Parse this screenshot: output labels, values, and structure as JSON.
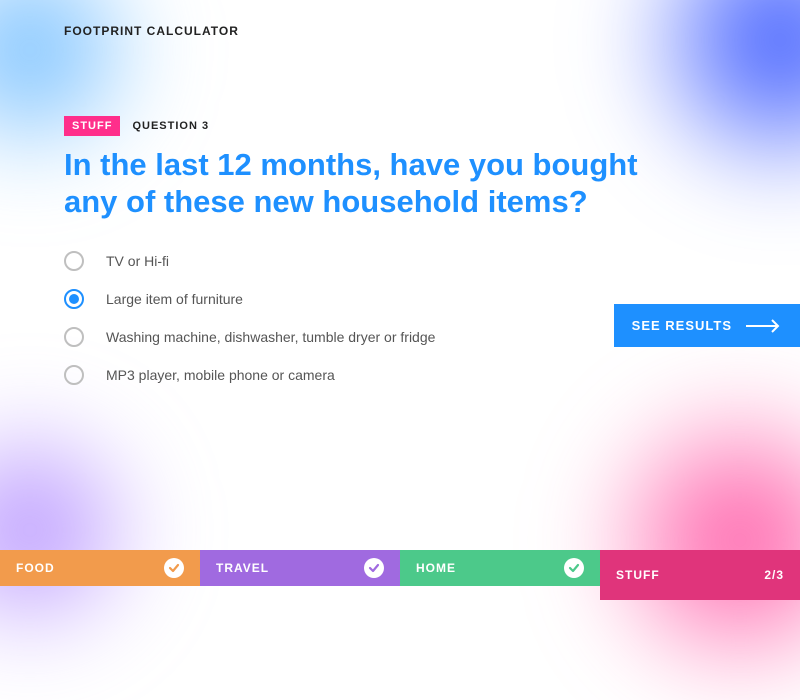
{
  "app": {
    "title": "FOOTPRINT CALCULATOR"
  },
  "current": {
    "category": "STUFF",
    "question_label": "QUESTION 3",
    "question": "In the last 12 months, have you bought any of these new household items?"
  },
  "options": [
    {
      "label": "TV or Hi-fi",
      "selected": false
    },
    {
      "label": "Large item of furniture",
      "selected": true
    },
    {
      "label": "Washing machine, dishwasher, tumble dryer or fridge",
      "selected": false
    },
    {
      "label": "MP3 player, mobile phone or camera",
      "selected": false
    }
  ],
  "cta": {
    "label": "SEE RESULTS"
  },
  "nav": {
    "food": {
      "label": "FOOD",
      "complete": true
    },
    "travel": {
      "label": "TRAVEL",
      "complete": true
    },
    "home": {
      "label": "HOME",
      "complete": true
    },
    "stuff": {
      "label": "STUFF",
      "progress": "2/3"
    }
  }
}
